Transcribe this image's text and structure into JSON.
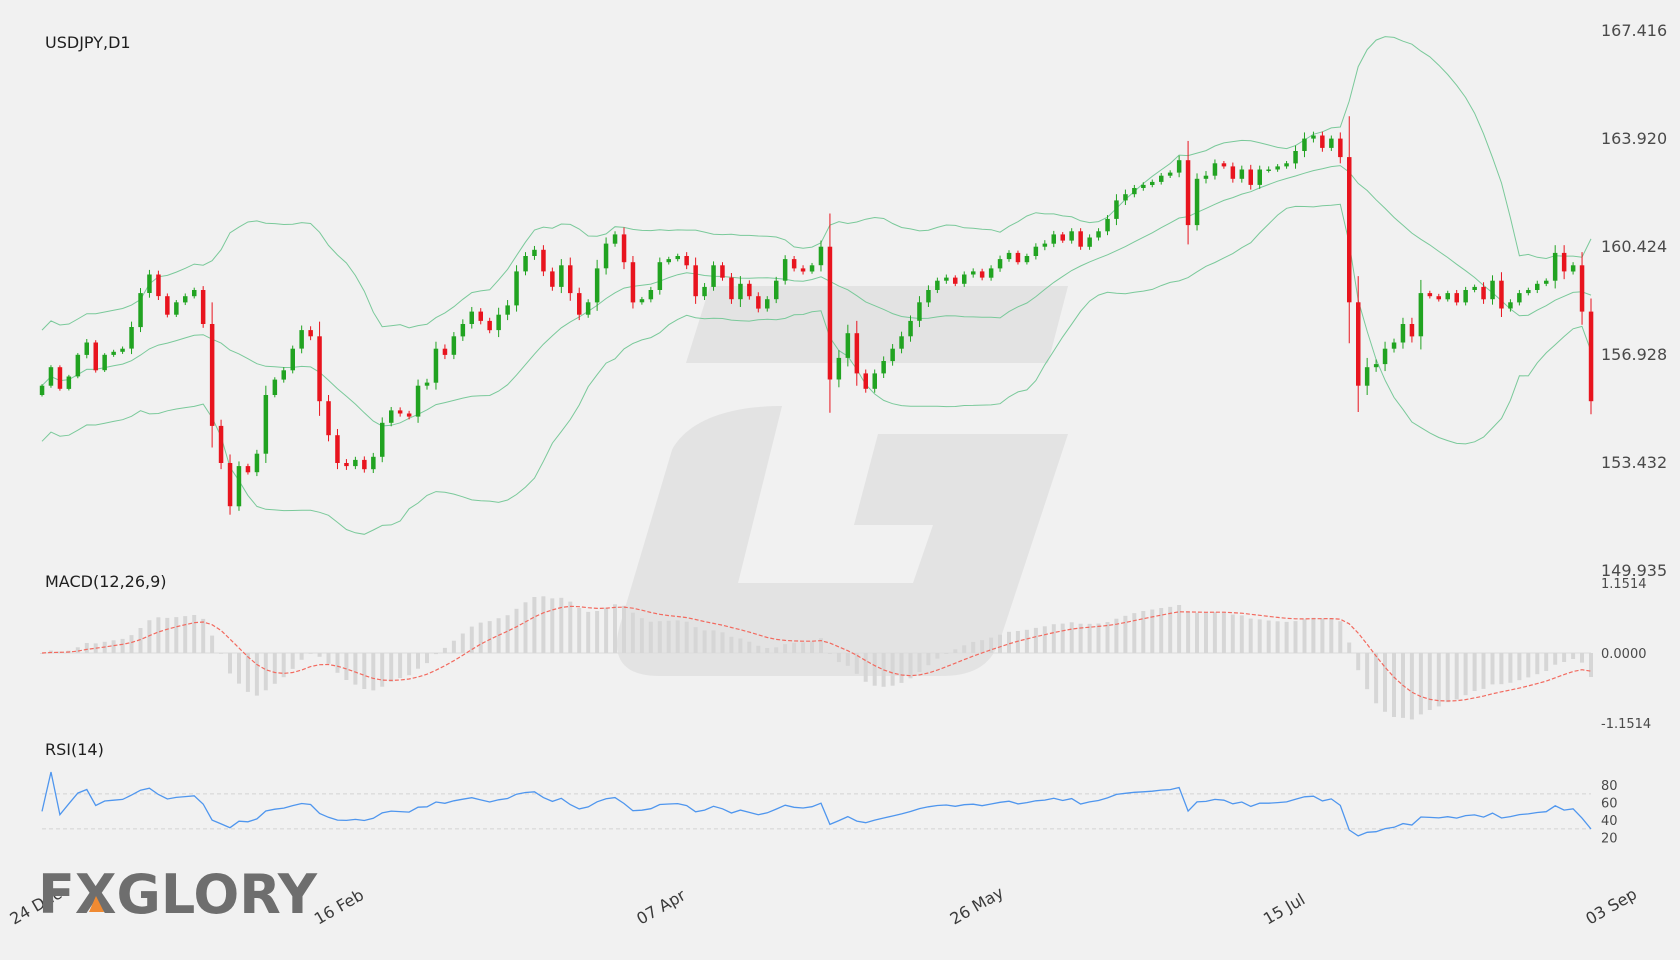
{
  "logo": {
    "brand": "FXGLORY"
  },
  "chart_data": [
    {
      "type": "candlestick",
      "title": "USDJPY,D1",
      "ylim": [
        149.935,
        167.416
      ],
      "y_ticks": [
        "167.416",
        "163.920",
        "160.424",
        "156.928",
        "153.432",
        "149.935"
      ],
      "y_tick_values": [
        167.416,
        163.92,
        160.424,
        156.928,
        153.432,
        149.935
      ],
      "x_labels": [
        "24 Dec",
        "16 Feb",
        "07 Apr",
        "26 May",
        "15 Jul",
        "03 Sep"
      ],
      "x_label_index": [
        0,
        34,
        70,
        105,
        140,
        176
      ],
      "colors": {
        "up": "#21a321",
        "down": "#e8141e",
        "bands": "#7ac99a"
      },
      "close": [
        155.9,
        156.5,
        155.8,
        156.2,
        156.9,
        157.3,
        156.4,
        156.9,
        157.0,
        157.1,
        157.8,
        158.9,
        159.5,
        158.8,
        158.2,
        158.6,
        158.8,
        159.0,
        157.9,
        154.6,
        153.4,
        152.0,
        153.3,
        153.1,
        153.7,
        155.6,
        156.1,
        156.4,
        157.1,
        157.7,
        157.5,
        155.4,
        154.3,
        153.4,
        153.3,
        153.5,
        153.2,
        153.6,
        154.7,
        155.1,
        155.0,
        154.9,
        155.9,
        156.0,
        157.1,
        156.9,
        157.5,
        157.9,
        158.3,
        158.0,
        157.7,
        158.2,
        158.5,
        159.6,
        160.1,
        160.3,
        159.6,
        159.1,
        159.8,
        158.9,
        158.2,
        158.6,
        159.7,
        160.5,
        160.8,
        159.9,
        158.6,
        158.7,
        159.0,
        159.9,
        160.0,
        160.1,
        159.8,
        158.8,
        159.1,
        159.8,
        159.4,
        158.7,
        159.2,
        158.8,
        158.4,
        158.7,
        159.3,
        160.0,
        159.7,
        159.6,
        159.8,
        160.4,
        156.1,
        156.8,
        157.6,
        156.3,
        155.8,
        156.3,
        156.7,
        157.1,
        157.5,
        158.0,
        158.6,
        159.0,
        159.3,
        159.4,
        159.2,
        159.5,
        159.6,
        159.4,
        159.7,
        160.0,
        160.2,
        159.9,
        160.1,
        160.4,
        160.5,
        160.8,
        160.6,
        160.9,
        160.4,
        160.7,
        160.9,
        161.3,
        161.9,
        162.1,
        162.3,
        162.4,
        162.5,
        162.7,
        162.8,
        163.2,
        161.1,
        162.6,
        162.7,
        163.1,
        163.0,
        162.6,
        162.9,
        162.4,
        162.9,
        162.9,
        163.0,
        163.1,
        163.5,
        163.9,
        164.0,
        163.6,
        163.9,
        163.3,
        158.6,
        155.9,
        156.5,
        156.6,
        157.1,
        157.3,
        157.9,
        157.5,
        158.9,
        158.8,
        158.7,
        158.9,
        158.6,
        159.0,
        159.1,
        158.7,
        159.3,
        158.4,
        158.6,
        158.9,
        159.0,
        159.2,
        159.3,
        160.2,
        159.6,
        159.8,
        158.3,
        155.4
      ],
      "volatility": [
        0.2,
        0.26,
        0.24,
        0.21,
        0.23,
        0.45,
        0.3,
        0.22,
        0.26,
        0.28,
        0.7,
        0.65,
        0.6,
        0.5,
        0.35,
        0.3,
        0.35,
        0.3,
        0.5,
        2.8,
        0.8,
        1.1,
        0.6,
        0.3,
        0.5,
        1.2,
        0.3,
        0.4,
        0.4,
        0.6,
        0.5,
        1.9,
        0.8,
        0.8,
        0.5,
        0.4,
        0.45,
        0.5,
        0.7,
        0.45,
        0.4,
        0.35,
        0.8,
        0.5,
        0.9,
        0.55,
        0.55,
        0.6,
        0.6,
        0.45,
        0.4,
        0.9,
        0.7,
        0.8,
        0.5,
        0.5,
        0.6,
        0.5,
        0.8,
        1.0,
        0.7,
        0.4,
        1.1,
        0.8,
        0.4,
        0.9,
        0.8,
        0.3,
        0.4,
        0.6,
        0.3,
        0.3,
        0.5,
        1.0,
        0.5,
        0.5,
        0.4,
        0.6,
        1.0,
        0.45,
        0.5,
        0.4,
        0.5,
        0.5,
        0.4,
        0.4,
        0.3,
        0.8,
        4.3,
        1.0,
        1.1,
        1.6,
        0.5,
        0.5,
        0.6,
        0.6,
        0.6,
        0.7,
        0.8,
        0.6,
        0.4,
        0.4,
        0.3,
        0.4,
        0.4,
        0.35,
        0.4,
        0.45,
        0.35,
        0.3,
        0.3,
        0.45,
        0.45,
        0.45,
        0.3,
        0.4,
        0.4,
        0.4,
        0.4,
        0.5,
        0.8,
        0.6,
        0.4,
        0.35,
        0.3,
        0.35,
        0.3,
        0.6,
        2.5,
        0.7,
        0.6,
        0.5,
        0.3,
        0.5,
        0.5,
        0.6,
        0.5,
        0.4,
        0.3,
        0.3,
        0.7,
        0.8,
        0.5,
        0.5,
        0.4,
        0.8,
        5.3,
        3.4,
        1.2,
        0.6,
        0.9,
        0.5,
        0.8,
        0.8,
        1.7,
        0.3,
        0.3,
        0.3,
        0.4,
        0.4,
        0.3,
        0.6,
        0.7,
        1.1,
        0.4,
        0.4,
        0.3,
        0.4,
        0.3,
        1.0,
        1.0,
        0.4,
        1.7,
        1.7
      ]
    },
    {
      "type": "macd",
      "title": "MACD(12,26,9)",
      "ylim": [
        -1.1514,
        1.1514
      ],
      "y_ticks": [
        "1.1514",
        "0.0000",
        "-1.1514"
      ],
      "y_tick_values": [
        1.1514,
        0,
        -1.1514
      ],
      "colors": {
        "signal": "#f26a5f",
        "histogram": "#d6d6d6"
      }
    },
    {
      "type": "line",
      "title": "RSI(14)",
      "ylim": [
        15,
        95
      ],
      "y_ticks": [
        "80",
        "60",
        "40",
        "20"
      ],
      "y_tick_values": [
        80,
        60,
        40,
        20
      ],
      "levels": [
        70,
        30
      ],
      "colors": {
        "rsi": "#4f96ee",
        "levels": "#d2d2d2"
      }
    }
  ]
}
